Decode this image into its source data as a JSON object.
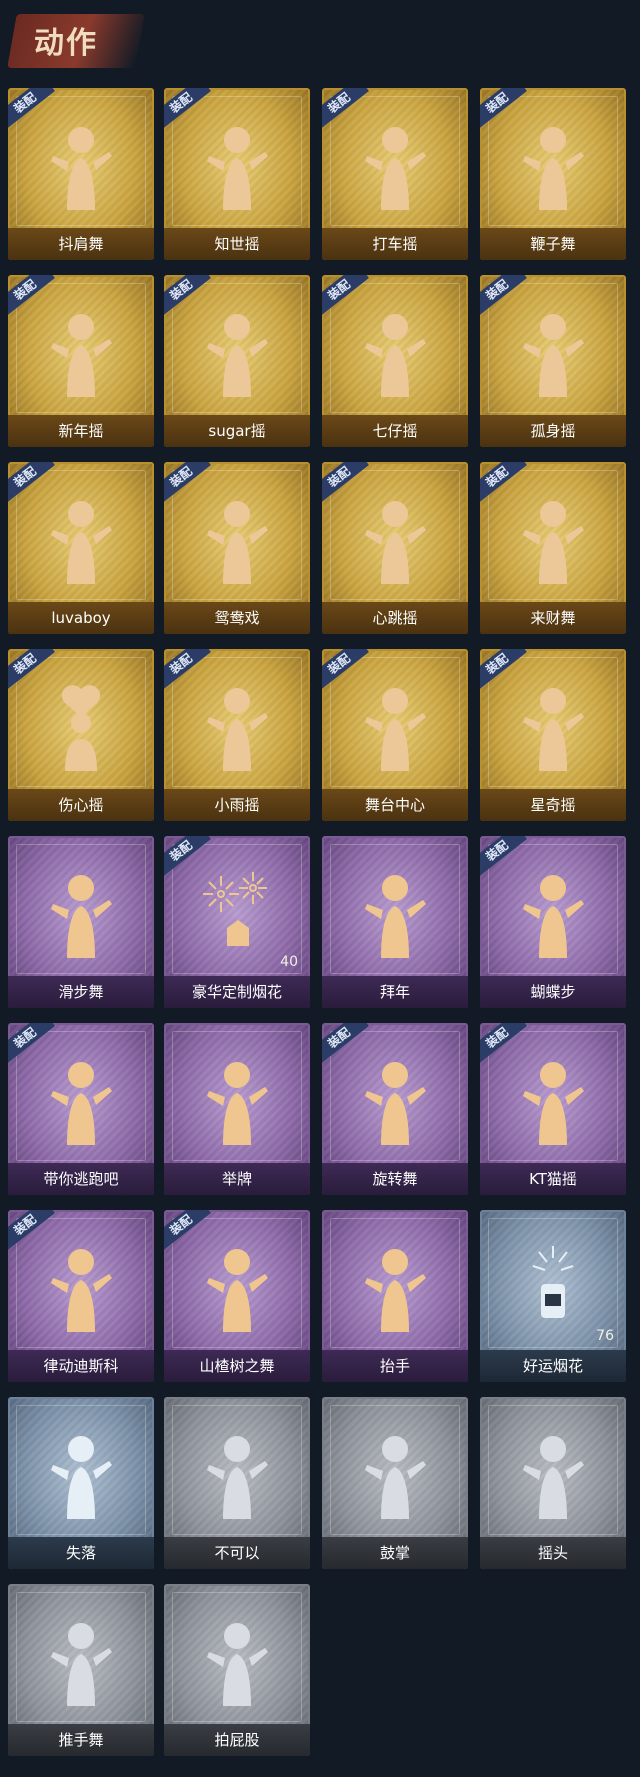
{
  "header": {
    "title": "动作"
  },
  "equip_badge_label": "装配",
  "colors": {
    "gold": "#c9a33e",
    "purple": "#8e6aa9",
    "blue": "#7d92aa",
    "gray": "#8e939b",
    "equip_badge": "#2b3d66"
  },
  "cards": [
    {
      "label": "抖肩舞",
      "rarity": "gold",
      "equipped": true,
      "icon": "dancer-figure-icon"
    },
    {
      "label": "知世摇",
      "rarity": "gold",
      "equipped": true,
      "icon": "dancer-figure-icon"
    },
    {
      "label": "打车摇",
      "rarity": "gold",
      "equipped": true,
      "icon": "dancer-figure-icon"
    },
    {
      "label": "鞭子舞",
      "rarity": "gold",
      "equipped": true,
      "icon": "dancer-figure-icon"
    },
    {
      "label": "新年摇",
      "rarity": "gold",
      "equipped": true,
      "icon": "dancer-figure-icon"
    },
    {
      "label": "sugar摇",
      "rarity": "gold",
      "equipped": true,
      "icon": "dancer-figure-icon"
    },
    {
      "label": "七仔摇",
      "rarity": "gold",
      "equipped": true,
      "icon": "dancer-figure-icon"
    },
    {
      "label": "孤身摇",
      "rarity": "gold",
      "equipped": true,
      "icon": "dancer-figure-icon"
    },
    {
      "label": "luvaboy",
      "rarity": "gold",
      "equipped": true,
      "icon": "dancer-figure-icon"
    },
    {
      "label": "鸳鸯戏",
      "rarity": "gold",
      "equipped": true,
      "icon": "dancer-figure-icon"
    },
    {
      "label": "心跳摇",
      "rarity": "gold",
      "equipped": true,
      "icon": "dancer-figure-icon"
    },
    {
      "label": "来财舞",
      "rarity": "gold",
      "equipped": true,
      "icon": "dancer-figure-icon"
    },
    {
      "label": "伤心摇",
      "rarity": "gold",
      "equipped": true,
      "icon": "heart-hands-figure-icon"
    },
    {
      "label": "小雨摇",
      "rarity": "gold",
      "equipped": true,
      "icon": "dancer-figure-icon"
    },
    {
      "label": "舞台中心",
      "rarity": "gold",
      "equipped": true,
      "icon": "dancer-figure-icon"
    },
    {
      "label": "星奇摇",
      "rarity": "gold",
      "equipped": true,
      "icon": "dancer-figure-icon"
    },
    {
      "label": "滑步舞",
      "rarity": "purple",
      "equipped": false,
      "icon": "dancer-figure-icon"
    },
    {
      "label": "豪华定制烟花",
      "rarity": "purple",
      "equipped": true,
      "icon": "fireworks-box-icon",
      "count": "40"
    },
    {
      "label": "拜年",
      "rarity": "purple",
      "equipped": false,
      "icon": "bowing-figure-icon"
    },
    {
      "label": "蝴蝶步",
      "rarity": "purple",
      "equipped": true,
      "icon": "dancer-figure-icon"
    },
    {
      "label": "带你逃跑吧",
      "rarity": "purple",
      "equipped": true,
      "icon": "dancer-figure-icon"
    },
    {
      "label": "举牌",
      "rarity": "purple",
      "equipped": false,
      "icon": "sign-holding-figure-icon"
    },
    {
      "label": "旋转舞",
      "rarity": "purple",
      "equipped": true,
      "icon": "spinning-figure-icon"
    },
    {
      "label": "KT猫摇",
      "rarity": "purple",
      "equipped": true,
      "icon": "dancer-figure-icon"
    },
    {
      "label": "律动迪斯科",
      "rarity": "purple",
      "equipped": true,
      "icon": "disco-figure-icon"
    },
    {
      "label": "山楂树之舞",
      "rarity": "purple",
      "equipped": true,
      "icon": "dancer-figure-icon"
    },
    {
      "label": "抬手",
      "rarity": "purple",
      "equipped": false,
      "icon": "raise-hand-figure-icon"
    },
    {
      "label": "好运烟花",
      "rarity": "blue",
      "equipped": false,
      "icon": "firework-can-icon",
      "count": "76"
    },
    {
      "label": "失落",
      "rarity": "blue",
      "equipped": false,
      "icon": "crawling-figure-icon"
    },
    {
      "label": "不可以",
      "rarity": "gray",
      "equipped": false,
      "icon": "finger-wag-icon"
    },
    {
      "label": "鼓掌",
      "rarity": "gray",
      "equipped": false,
      "icon": "clapping-hands-icon"
    },
    {
      "label": "摇头",
      "rarity": "gray",
      "equipped": false,
      "icon": "head-shake-figure-icon"
    },
    {
      "label": "推手舞",
      "rarity": "gray",
      "equipped": false,
      "icon": "push-hands-figure-icon"
    },
    {
      "label": "拍屁股",
      "rarity": "gray",
      "equipped": false,
      "icon": "butt-pat-figure-icon"
    }
  ]
}
